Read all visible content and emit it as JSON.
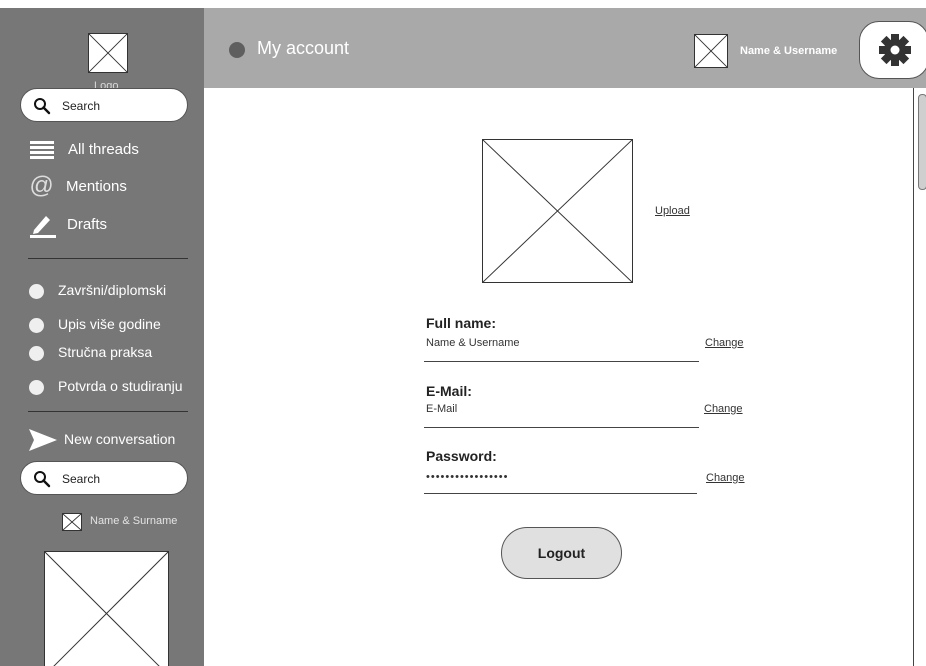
{
  "sidebar": {
    "logo_label": "Logo",
    "search_top_placeholder": "Search",
    "nav": [
      {
        "label": "All threads",
        "icon": "list-icon"
      },
      {
        "label": "Mentions",
        "icon": "at-icon"
      },
      {
        "label": "Drafts",
        "icon": "pencil-icon"
      }
    ],
    "channels": [
      {
        "label": "Završni/diplomski"
      },
      {
        "label": "Upis više godine"
      },
      {
        "label": "Stručna praksa"
      },
      {
        "label": "Potvrda o studiranju"
      }
    ],
    "new_conversation": "New conversation",
    "search_bottom_placeholder": "Search",
    "user_name": "Name & Surname"
  },
  "header": {
    "title": "My account",
    "user_name": "Name & Username",
    "settings_icon": "gear-icon"
  },
  "main": {
    "upload_label": "Upload",
    "fields": [
      {
        "label": "Full name:",
        "value": "Name & Username",
        "action": "Change"
      },
      {
        "label": "E-Mail:",
        "value": "E-Mail",
        "action": "Change"
      },
      {
        "label": "Password:",
        "value": "•••••••••••••••••",
        "action": "Change"
      }
    ],
    "logout_label": "Logout"
  },
  "colors": {
    "sidebar_bg": "#777777",
    "header_bg": "#a9a9a9",
    "button_bg": "#e0e0e0"
  }
}
